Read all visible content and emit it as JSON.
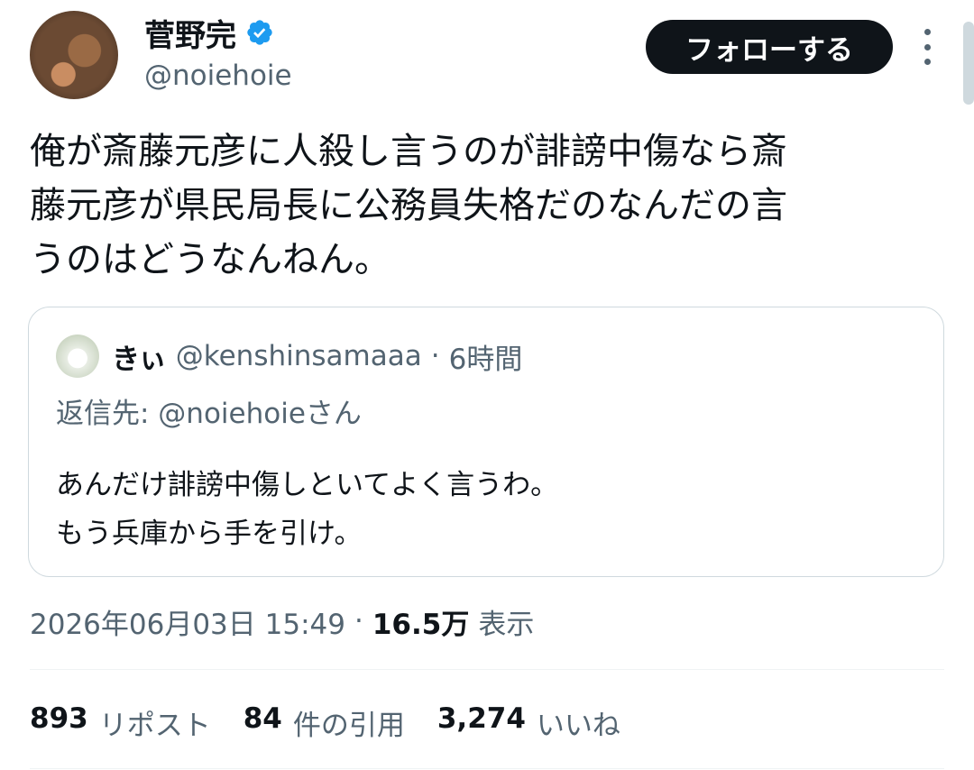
{
  "author": {
    "name": "菅野完",
    "handle": "@noiehoie",
    "verified": true
  },
  "follow_button": {
    "label": "フォローする"
  },
  "tweet": {
    "text": "俺が斎藤元彦に人殺し言うのが誹謗中傷なら斎\n藤元彦が県民局長に公務員失格だのなんだの言\nうのはどうなんねん。"
  },
  "quote": {
    "name": "きぃ",
    "handle": "@kenshinsamaaa",
    "separator": "·",
    "time": "6時間",
    "reply_to": "返信先: @noiehoieさん",
    "text": "あんだけ誹謗中傷しといてよく言うわ。\nもう兵庫から手を引け。"
  },
  "meta": {
    "datetime": "2026年06月03日 15:49",
    "separator": "·",
    "views": "16.5万",
    "views_label": "表示"
  },
  "stats": {
    "reposts": {
      "num": "893",
      "label": "リポスト"
    },
    "quotes": {
      "num": "84",
      "label": "件の引用"
    },
    "likes": {
      "num": "3,274",
      "label": "いいね"
    }
  },
  "colors": {
    "text": "#0f1419",
    "secondary": "#536471",
    "verified": "#1d9bf0",
    "border": "#cfd9de"
  }
}
